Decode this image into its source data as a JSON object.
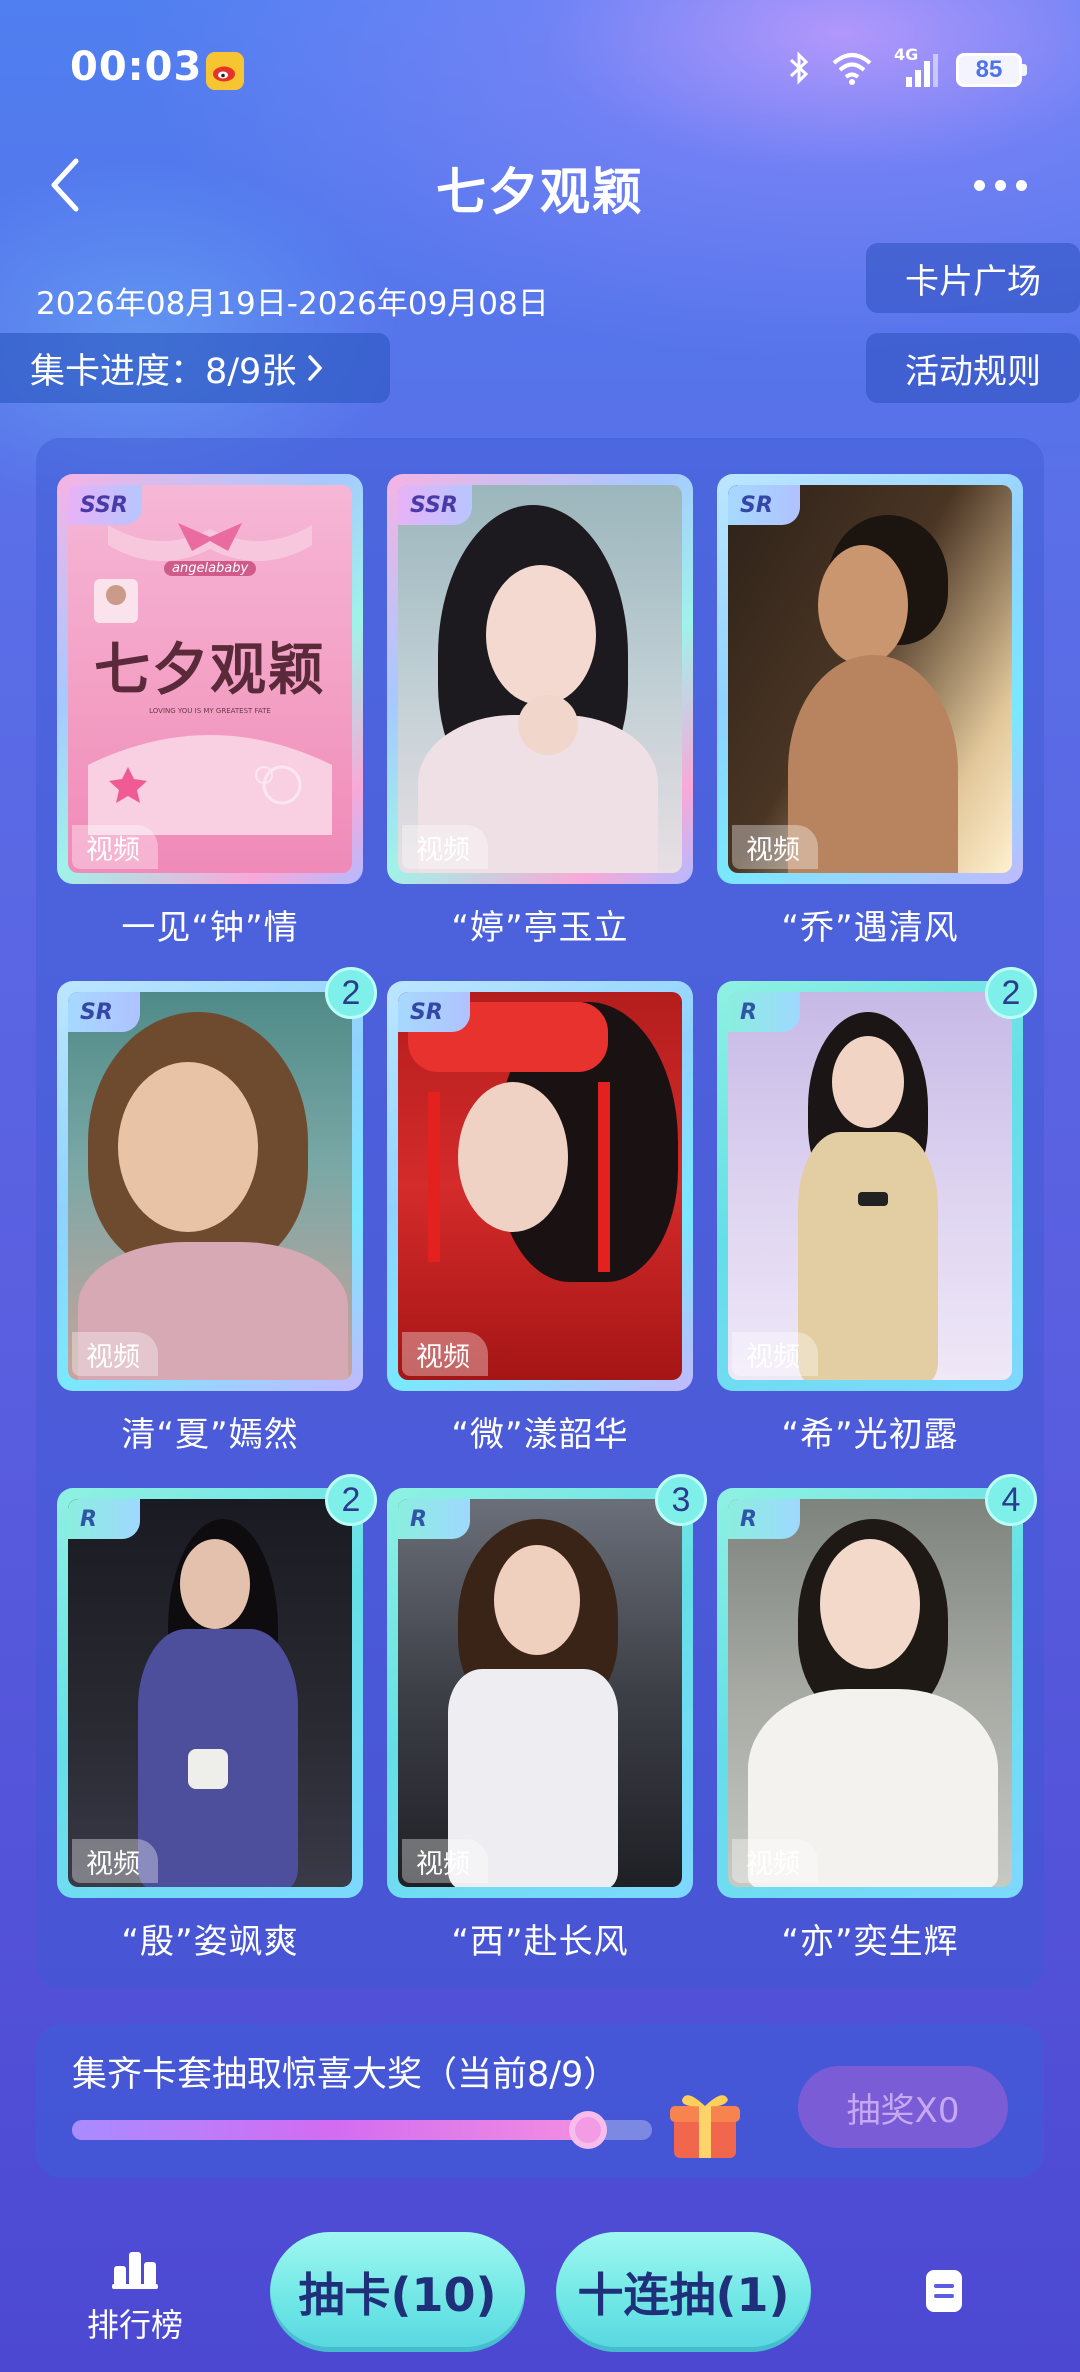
{
  "status_bar": {
    "time": "00:03",
    "network": "4G",
    "battery": "85"
  },
  "header": {
    "title": "七夕观颖"
  },
  "date_range": "2026年08月19日-2026年09月08日",
  "progress_label": "集卡进度：8/9张",
  "side_buttons": {
    "card_square": "卡片广场",
    "rules": "活动规则"
  },
  "cards": [
    {
      "rarity": "SSR",
      "tag": "视频",
      "caption": "一见“钟”情",
      "count": ""
    },
    {
      "rarity": "SSR",
      "tag": "视频",
      "caption": "“婷”亭玉立",
      "count": ""
    },
    {
      "rarity": "SR",
      "tag": "视频",
      "caption": "“乔”遇清风",
      "count": ""
    },
    {
      "rarity": "SR",
      "tag": "视频",
      "caption": "清“夏”嫣然",
      "count": "2"
    },
    {
      "rarity": "SR",
      "tag": "视频",
      "caption": "“微”漾韶华",
      "count": ""
    },
    {
      "rarity": "R",
      "tag": "视频",
      "caption": "“希”光初露",
      "count": "2"
    },
    {
      "rarity": "R",
      "tag": "视频",
      "caption": "“殷”姿飒爽",
      "count": "2"
    },
    {
      "rarity": "R",
      "tag": "视频",
      "caption": "“西”赴长风",
      "count": "3"
    },
    {
      "rarity": "R",
      "tag": "视频",
      "caption": "“亦”奕生辉",
      "count": "4"
    }
  ],
  "card1_poster": {
    "brand": "angelababy",
    "title": "七夕观颖",
    "tagline": "LOVING YOU IS MY GREATEST FATE"
  },
  "prize": {
    "text": "集齐卡套抽取惊喜大奖（当前8/9）",
    "progress": 0.89,
    "draw_button": "抽奖X0"
  },
  "bottom": {
    "rank_label": "排行榜",
    "draw_one": "抽卡(10)",
    "draw_ten": "十连抽(1)"
  }
}
